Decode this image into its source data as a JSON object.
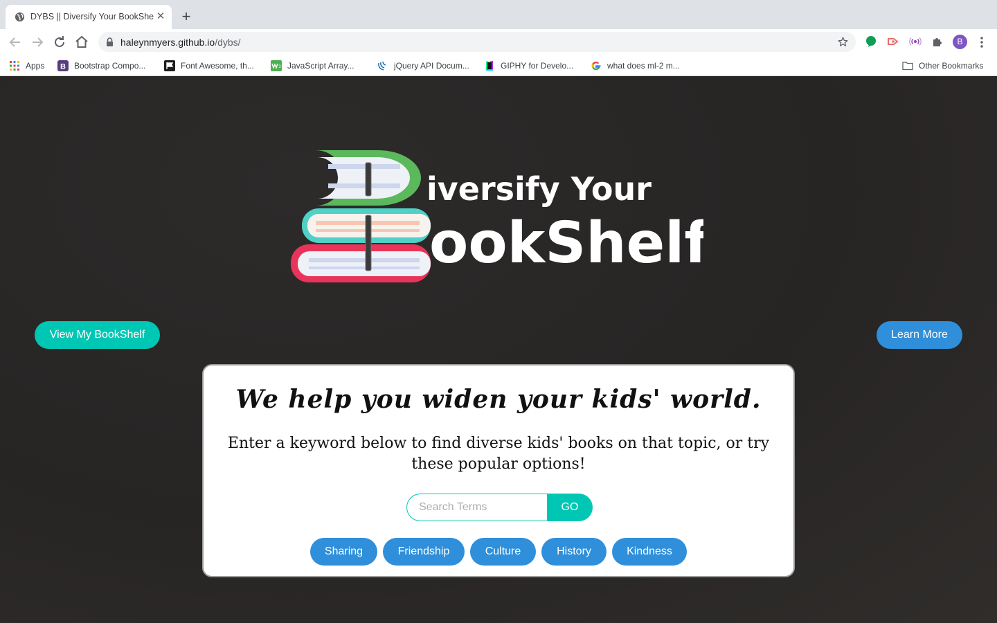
{
  "browser": {
    "tab": {
      "title": "DYBS || Diversify Your BookShelf",
      "favicon": "globe-icon"
    },
    "address": {
      "host": "haleynmyers.github.io",
      "path": "/dybs/"
    },
    "avatar_letter": "B",
    "extensions": [
      "green-speech-icon",
      "red-arrow-icon",
      "purple-broadcast-icon",
      "puzzle-icon"
    ],
    "bookmarks": [
      {
        "label": "Apps",
        "icon": "apps-grid-icon"
      },
      {
        "label": "Bootstrap Compo...",
        "icon": "bootstrap-icon"
      },
      {
        "label": "Font Awesome, th...",
        "icon": "font-awesome-flag-icon"
      },
      {
        "label": "JavaScript Array...",
        "icon": "w3-icon"
      },
      {
        "label": "jQuery API Docum...",
        "icon": "jquery-icon"
      },
      {
        "label": "GIPHY for Develo...",
        "icon": "giphy-icon"
      },
      {
        "label": "what does ml-2 m...",
        "icon": "google-icon"
      }
    ],
    "other_bookmarks": "Other Bookmarks"
  },
  "page": {
    "logo": {
      "line1": "iversify Your",
      "line2": "ookShelf"
    },
    "view_bookshelf_label": "View My BookShelf",
    "learn_more_label": "Learn More",
    "card": {
      "heading": "We help you widen your kids' world.",
      "subheading": "Enter a keyword below to find diverse kids' books on that topic, or try these popular options!",
      "search_placeholder": "Search Terms",
      "go_label": "GO",
      "topics": [
        "Sharing",
        "Friendship",
        "Culture",
        "History",
        "Kindness"
      ]
    }
  },
  "colors": {
    "teal": "#00c7b3",
    "blue": "#2f8fda",
    "background": "#2b2928",
    "book_green": "#5cb85c",
    "book_cyan": "#4fd1c5",
    "book_red": "#e8345a"
  }
}
